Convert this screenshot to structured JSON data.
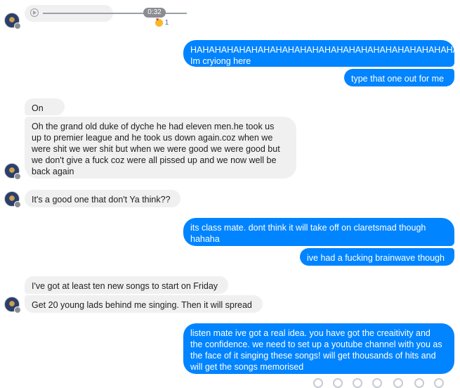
{
  "audio": {
    "duration": "0:32",
    "reaction_count": "1"
  },
  "messages": {
    "out1": "HAHAHAHAHAHAHAHAHAHAHAHAHAHAHAHAHAHAHAHAHAHAHA\nIm cryiong here",
    "out2": "type that one out for me",
    "in1": "On sec",
    "in2": "Oh the grand old duke of dyche he had eleven men.he took us\nup to premier league and he took us down again.coz when we\nwere shit we wer shit but when we were good we were good but\nwe don't give a fuck coz were all pissed up and we now well be\nback again",
    "in3": "It's a good one that don't Ya think??",
    "out3": "its class mate. dont think it will take off on claretsmad though\nhahaha",
    "out4": "ive had a fucking brainwave though",
    "in4": "I've got at least ten new songs to start on Friday",
    "in5": "Get 20 young lads behind me singing. Then it will spread",
    "out5": "listen mate ive got a real idea. you have got the creaitivity and\nthe confidence. we need to set up a youtube channel with you as\nthe face of it singing these songs! will get thousands of hits and\nwill get the songs memorised"
  },
  "colors": {
    "outgoing": "#0084ff",
    "incoming": "#f1f0f0"
  }
}
